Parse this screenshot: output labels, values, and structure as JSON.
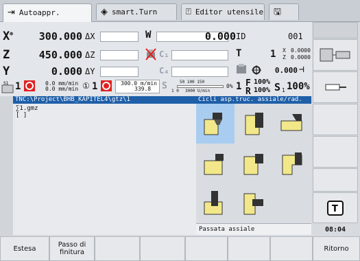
{
  "tabs": [
    {
      "label": "Autoappr.",
      "icon": "arrow-right-box-icon"
    },
    {
      "label": "smart.Turn",
      "icon": "arrow-diamond-icon"
    },
    {
      "label": "Editor utensile",
      "icon": "tool-editor-icon"
    },
    {
      "label": "",
      "icon": "save-icon"
    }
  ],
  "axes": {
    "x": {
      "label": "X",
      "sup": "⊕",
      "value": "300.000",
      "delta_label": "ΔX"
    },
    "z": {
      "label": "Z",
      "value": "450.000",
      "delta_label": "ΔZ"
    },
    "y": {
      "label": "Y",
      "value": "0.000",
      "delta_label": "ΔY"
    }
  },
  "status": {
    "w_label": "W",
    "w_value": "0.000",
    "id_label": "ID",
    "id_value": "001",
    "c1_label": "C₁",
    "c4_label": "C₄",
    "t_label": "T",
    "t_value": "1",
    "x_offset_label": "X",
    "x_offset": "0.0000",
    "z_offset_label": "Z",
    "z_offset": "0.0000",
    "third_value": "0.000",
    "s1_label": "S1",
    "spindle_num": "1",
    "feed1": "0.0 mm/min",
    "feed2": "0.0 mm/min",
    "ch1": "1",
    "ch1b": "1",
    "feed3": "300.0 m/min",
    "feed4": "339.8",
    "s_label": "S",
    "s_scale": "50    100   150",
    "s_sub": "1 0",
    "s_speed": "3000 U/min",
    "pct": "0%",
    "f_label": "F",
    "f_pct": "100%",
    "r_label": "R",
    "r_pct": "100%",
    "s_pct_label": "S",
    "s_pct_idx": "1",
    "s_pct": "100%"
  },
  "program": {
    "path": "TNC:\\Project\\BHB_KAPITEL4\\gtz\\1",
    "lines": [
      "∑1.gmz",
      "[ ]"
    ]
  },
  "cycles": {
    "title": "Cicli asp.truc. assiale/rad.",
    "footer": "Passata assiale"
  },
  "clock": "08:04",
  "softkeys_bottom": [
    {
      "label": "Estesa"
    },
    {
      "label": "Passo di finitura"
    },
    {
      "label": ""
    },
    {
      "label": ""
    },
    {
      "label": ""
    },
    {
      "label": ""
    },
    {
      "label": ""
    },
    {
      "label": "Ritorno"
    }
  ],
  "colors": {
    "accent": "#1f5fa8",
    "selected_cell": "#a8cdf0",
    "workpiece": "#f2e88a",
    "alert_red": "#e02020"
  }
}
